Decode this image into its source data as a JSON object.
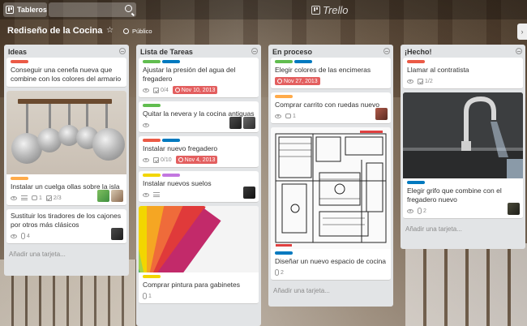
{
  "header": {
    "boards_label": "Tableros",
    "logo_text": "Trello"
  },
  "board": {
    "title": "Rediseño de la Cocina",
    "visibility": "Público"
  },
  "colors": {
    "green": "#61bd4f",
    "yellow": "#f2d600",
    "orange": "#ffab4a",
    "red": "#eb5a46",
    "purple": "#c377e0",
    "blue": "#0079bf",
    "due_red": "#e35f5f"
  },
  "lists": [
    {
      "title": "Ideas",
      "add_card": "Añadir una tarjeta...",
      "cards": [
        {
          "labels": [
            "red"
          ],
          "text": "Conseguir una cenefa nueva que combine con los colores del armario"
        },
        {
          "cover": "pots-image",
          "labels": [
            "orange"
          ],
          "text": "Instalar un cuelga ollas sobre la isla",
          "badges": {
            "comments": "1",
            "checklist": "2/3"
          }
        },
        {
          "text": "Sustituir los tiradores de los cajones por otros más clásicos",
          "badges": {
            "attachments": "4"
          }
        }
      ]
    },
    {
      "title": "Lista de Tareas",
      "add_card": "",
      "cards": [
        {
          "labels": [
            "green",
            "blue"
          ],
          "text": "Ajustar la presión del agua del fregadero",
          "badges": {
            "checklist": "0/4",
            "due": "Nov 10, 2013"
          }
        },
        {
          "labels": [
            "green"
          ],
          "text": "Quitar la nevera y la cocina antiguas"
        },
        {
          "labels": [
            "red",
            "blue"
          ],
          "text": "Instalar nuevo fregadero",
          "badges": {
            "checklist": "0/10",
            "due": "Nov 4, 2013"
          }
        },
        {
          "labels": [
            "yellow",
            "purple"
          ],
          "text": "Instalar nuevos suelos"
        },
        {
          "cover": "color-swatch-image",
          "labels": [
            "yellow"
          ],
          "text": "Comprar pintura para gabinetes",
          "badges": {
            "attachments": "1"
          }
        }
      ]
    },
    {
      "title": "En proceso",
      "add_card": "Añadir una tarjeta...",
      "cards": [
        {
          "labels": [
            "green",
            "blue"
          ],
          "text": "Elegir colores de las encimeras",
          "badges": {
            "due": "Nov 27, 2013"
          }
        },
        {
          "labels": [
            "orange"
          ],
          "text": "Comprar carrito con ruedas nuevo",
          "badges": {
            "comments": "1"
          }
        },
        {
          "cover": "floor-plan-image",
          "labels": [
            "blue"
          ],
          "text": "Diseñar un nuevo espacio de cocina",
          "badges": {
            "attachments": "2"
          }
        }
      ]
    },
    {
      "title": "¡Hecho!",
      "add_card": "Añadir una tarjeta...",
      "cards": [
        {
          "labels": [
            "red"
          ],
          "text": "Llamar al contratista",
          "badges": {
            "checklist": "1/2"
          }
        },
        {
          "cover": "faucet-image",
          "labels": [
            "blue"
          ],
          "text": "Elegir grifo que combine con el fregadero nuevo",
          "badges": {
            "attachments": "2"
          }
        }
      ]
    }
  ]
}
